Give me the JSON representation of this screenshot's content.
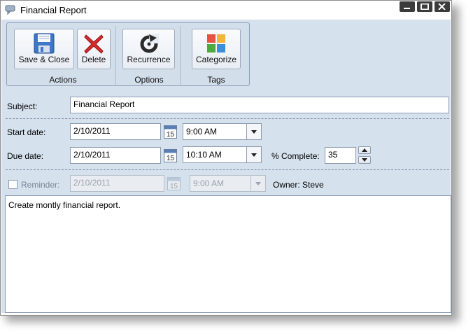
{
  "window": {
    "title": "Financial Report",
    "controls": [
      "minimize",
      "maximize",
      "close"
    ]
  },
  "ribbon": {
    "groups": [
      {
        "label": "Actions",
        "buttons": [
          {
            "label": "Save & Close",
            "icon": "floppy-disk-icon"
          },
          {
            "label": "Delete",
            "icon": "red-x-icon"
          }
        ]
      },
      {
        "label": "Options",
        "buttons": [
          {
            "label": "Recurrence",
            "icon": "recurrence-arrow-icon"
          }
        ]
      },
      {
        "label": "Tags",
        "buttons": [
          {
            "label": "Categorize",
            "icon": "color-squares-icon"
          }
        ]
      }
    ]
  },
  "form": {
    "subject_label": "Subject:",
    "subject_value": "Financial Report",
    "start_label": "Start date:",
    "start_date": "2/10/2011",
    "start_time": "9:00 AM",
    "due_label": "Due date:",
    "due_date": "2/10/2011",
    "due_time": "10:10 AM",
    "percent_label": "% Complete:",
    "percent_value": "35",
    "reminder_label": "Reminder:",
    "reminder_checked": false,
    "reminder_date": "2/10/2011",
    "reminder_time": "9:00 AM",
    "owner_label": "Owner: Steve",
    "calendar_day": "15"
  },
  "notes": "Create montly financial report.",
  "colors": {
    "panel_bg": "#d6e1ee",
    "categorize": [
      "#e8523f",
      "#f1b53c",
      "#4caa3f",
      "#3f8fd8"
    ]
  }
}
